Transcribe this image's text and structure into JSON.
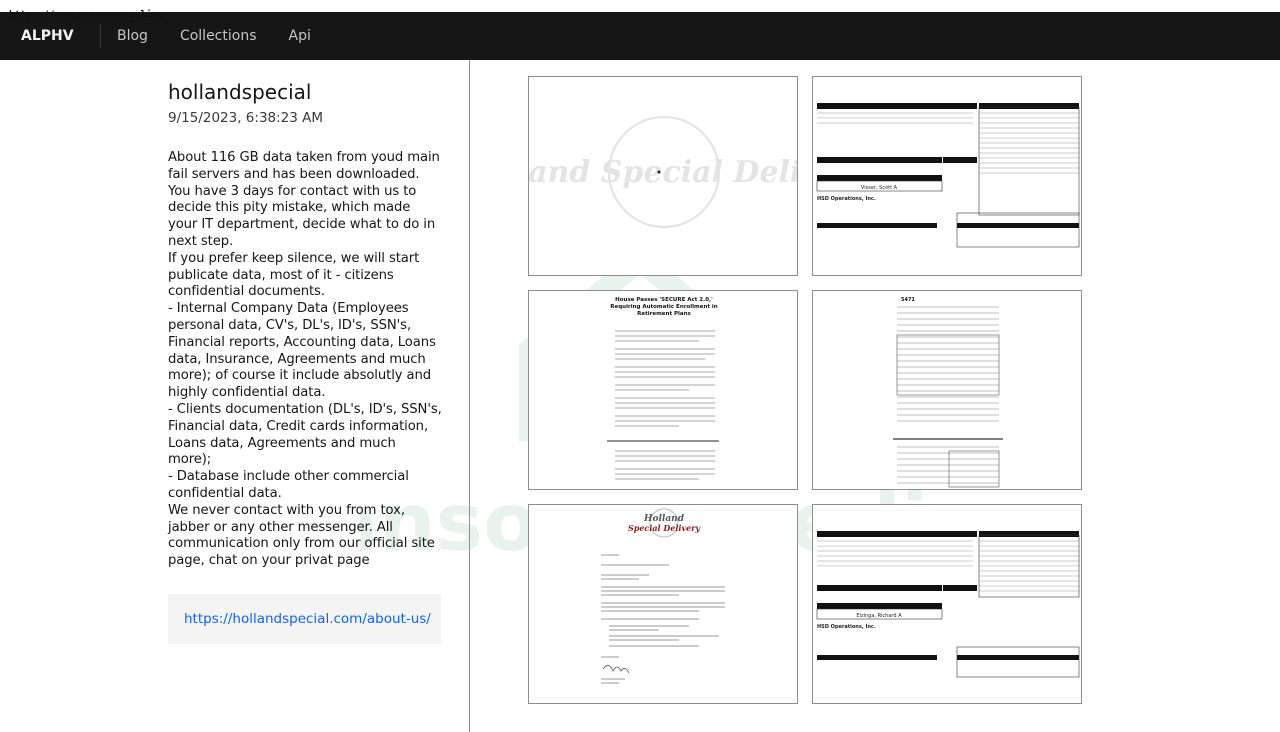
{
  "url_stamp": "https://www.ransomware.live",
  "nav": {
    "brand": "ALPHV",
    "links": [
      "Blog",
      "Collections",
      "Api"
    ]
  },
  "post": {
    "title": "hollandspecial",
    "date": "9/15/2023, 6:38:23 AM",
    "body": "About 116 GB data taken from youd main fail servers and has been downloaded.\nYou have 3 days for contact with us to decide this pity mistake, which made your IT department, decide what to do in next step.\nIf you prefer keep silence, we will start publicate data, most of it - citizens confidential documents.\n- Internal Company Data (Employees personal data, CV's, DL's, ID's, SSN's, Financial reports, Accounting data, Loans data, Insurance, Agreements and much more); of course it include absolutly and highly confidential data.\n- Clients documentation (DL's, ID's, SSN's, Financial data, Credit cards information, Loans data, Agreements and much more);\n- Database include other commercial confidential data.\nWe never contact with you from tox, jabber or any other messenger. All communication only from our official site page, chat on your privat page",
    "link": "https://hollandspecial.com/about-us/"
  },
  "thumbnails": [
    {
      "kind": "logo-blank",
      "text": "Holland Special Delivery"
    },
    {
      "kind": "paystub",
      "company": "HSD Operations, Inc.",
      "employee": "Visser, Scott A"
    },
    {
      "kind": "article",
      "heading": "House Passes 'SECURE Act 2.0,' Requiring Automatic Enrollment in Retirement Plans"
    },
    {
      "kind": "form",
      "form_no": "5471"
    },
    {
      "kind": "letter",
      "company": "Holland Special Delivery"
    },
    {
      "kind": "paystub",
      "company": "HSD Operations, Inc.",
      "employee": "Elzinga, Richard A"
    }
  ],
  "watermark_text": "ransomware.live"
}
